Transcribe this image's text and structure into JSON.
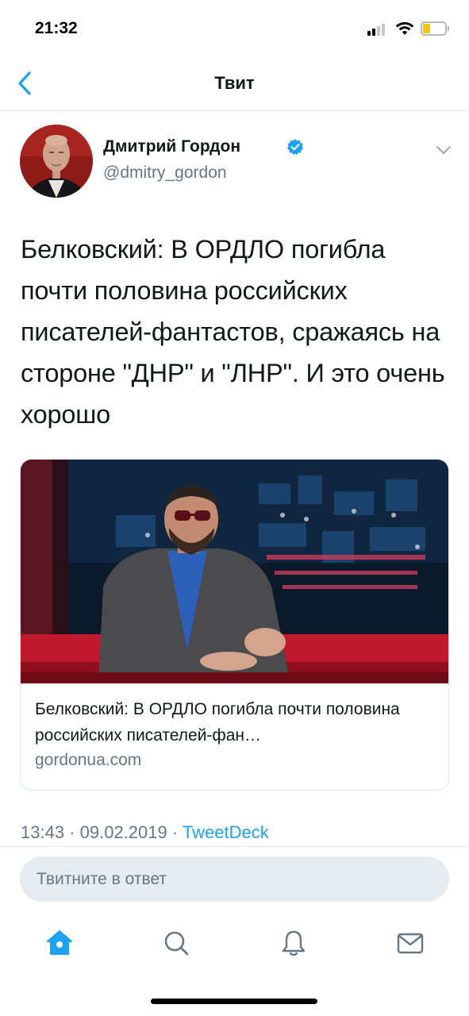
{
  "status_bar": {
    "time": "21:32"
  },
  "nav": {
    "title": "Твит"
  },
  "tweet": {
    "author_name": "Дмитрий Гордон",
    "handle": "@dmitry_gordon",
    "text": "Белковский: В ОРДЛО погибла почти половина российских писателей-фантастов, сражаясь на стороне \"ДНР\" и \"ЛНР\". И это очень хорошо",
    "card": {
      "title": "Белковский: В ОРДЛО погибла почти половина российских писателей-фан…",
      "domain": "gordonua.com"
    },
    "time": "13:43",
    "separator": " · ",
    "date": "09.02.2019",
    "source": "TweetDeck"
  },
  "reply": {
    "placeholder": "Твитните в ответ"
  },
  "tabs": [
    {
      "icon": "home-icon"
    },
    {
      "icon": "search-icon"
    },
    {
      "icon": "bell-icon"
    },
    {
      "icon": "mail-icon"
    }
  ],
  "colors": {
    "accent": "#1da1f2",
    "secondary_text": "#657786",
    "text": "#14171a",
    "border": "#e1e8ed"
  }
}
